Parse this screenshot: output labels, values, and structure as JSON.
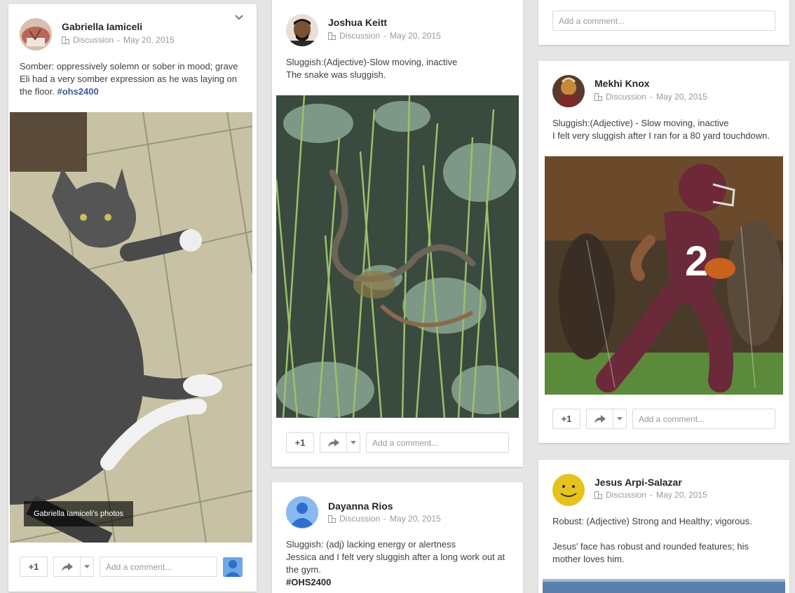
{
  "posts": [
    {
      "author": "Gabriella Iamiceli",
      "category": "Discussion",
      "date": "May 20, 2015",
      "text_lines": [
        "Somber: oppressively solemn or sober in mood; grave",
        "Eli had a very somber expression as he was laying on",
        "the floor. "
      ],
      "hashtag": "#ohs2400",
      "photo_caption": "Gabriella Iamiceli's photos"
    },
    {
      "author": "Joshua Keitt",
      "category": "Discussion",
      "date": "May 20, 2015",
      "text_lines": [
        "Sluggish:(Adjective)-Slow moving, inactive",
        "The snake was sluggish."
      ]
    },
    {
      "author": "Dayanna Rios",
      "category": "Discussion",
      "date": "May 20, 2015",
      "text_lines": [
        "Sluggish: (adj) lacking energy or alertness",
        "Jessica and I felt very sluggish after a long work out at",
        "the gym."
      ],
      "hashtag": "#OHS2400"
    },
    {
      "author": "Mekhi Knox",
      "category": "Discussion",
      "date": "May 20, 2015",
      "text_lines": [
        "Sluggish:(Adjective) - Slow moving, inactive",
        "I felt very sluggish after I ran for a 80 yard touchdown."
      ]
    },
    {
      "author": "Jesus Arpi-Salazar",
      "category": "Discussion",
      "date": "May 20, 2015",
      "text_lines": [
        "Robust: (Adjective) Strong and Healthy; vigorous.",
        "",
        "Jesus' face has robust and rounded features; his",
        "mother loves him."
      ]
    }
  ],
  "actions": {
    "plus_one": "+1",
    "comment_placeholder": "Add a comment..."
  },
  "icons": {
    "share": "share-arrow-icon",
    "dropdown": "caret-down-icon",
    "category": "community-icon",
    "menu": "chevron-down-icon"
  },
  "colors": {
    "background": "#e5e5e5",
    "card": "#ffffff",
    "hashtag": "#3b5998",
    "meta": "#999999"
  }
}
